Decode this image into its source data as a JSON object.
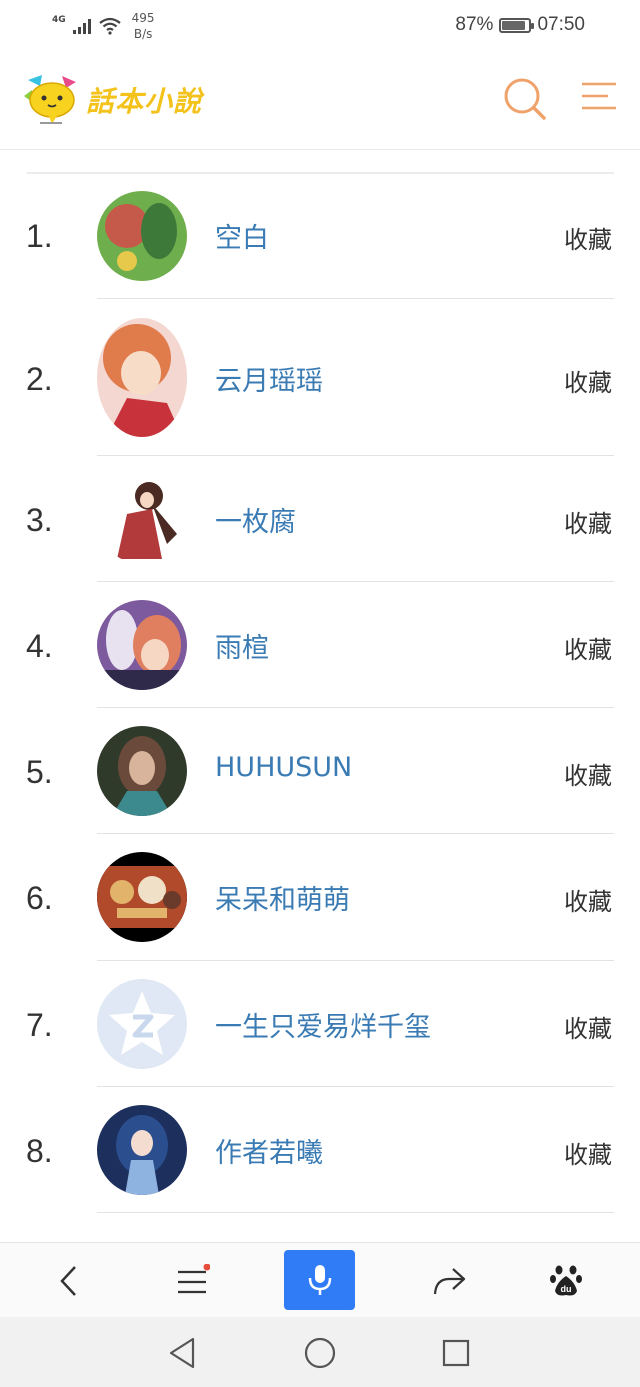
{
  "status_bar": {
    "network": "4G",
    "speed_value": "495",
    "speed_unit": "B/s",
    "battery_percent": "87%",
    "battery_level": 0.87,
    "time": "07:50"
  },
  "header": {
    "logo_text": "話本小說",
    "search_icon": "search-icon",
    "menu_icon": "menu-icon",
    "accent_color": "#f0a26b"
  },
  "ranking": {
    "favorite_label": "收藏",
    "items": [
      {
        "rank": "1.",
        "name": "空白",
        "avatar_colors": [
          "#c65a4a",
          "#6fae4d",
          "#3d7a3a"
        ]
      },
      {
        "rank": "2.",
        "name": "云月瑶瑶",
        "avatar_colors": [
          "#e07b4b",
          "#c7323b",
          "#f4d7d0"
        ]
      },
      {
        "rank": "3.",
        "name": "一枚腐",
        "avatar_colors": [
          "#ffffff",
          "#b23a3a",
          "#4a2a22"
        ]
      },
      {
        "rank": "4.",
        "name": "雨楦",
        "avatar_colors": [
          "#7d5a9e",
          "#e07f5f",
          "#2f2a4a"
        ]
      },
      {
        "rank": "5.",
        "name": "HUHUSUN",
        "avatar_colors": [
          "#2f3a2b",
          "#6a4a3a",
          "#3c8a8e"
        ]
      },
      {
        "rank": "6.",
        "name": "呆呆和萌萌",
        "avatar_colors": [
          "#000000",
          "#b04a2a",
          "#e2b36a"
        ]
      },
      {
        "rank": "7.",
        "name": "一生只爱易烊千玺",
        "avatar_colors": [
          "#dfe8f4",
          "#ffffff",
          "#c9d8ec"
        ]
      },
      {
        "rank": "8.",
        "name": "作者若曦",
        "avatar_colors": [
          "#2a4e8e",
          "#8fb3e0",
          "#1d2f5c"
        ]
      }
    ]
  },
  "browser_toolbar": {
    "back_icon": "chevron-left-icon",
    "menu_icon": "menu-icon",
    "mic_icon": "microphone-icon",
    "share_icon": "share-icon",
    "baidu_icon": "baidu-paw-icon",
    "baidu_text": "du",
    "mic_color": "#2f7cf6",
    "notification_dot_color": "#e74c3c"
  },
  "system_nav": {
    "back_icon": "triangle-back-icon",
    "home_icon": "circle-home-icon",
    "recents_icon": "square-recents-icon"
  }
}
